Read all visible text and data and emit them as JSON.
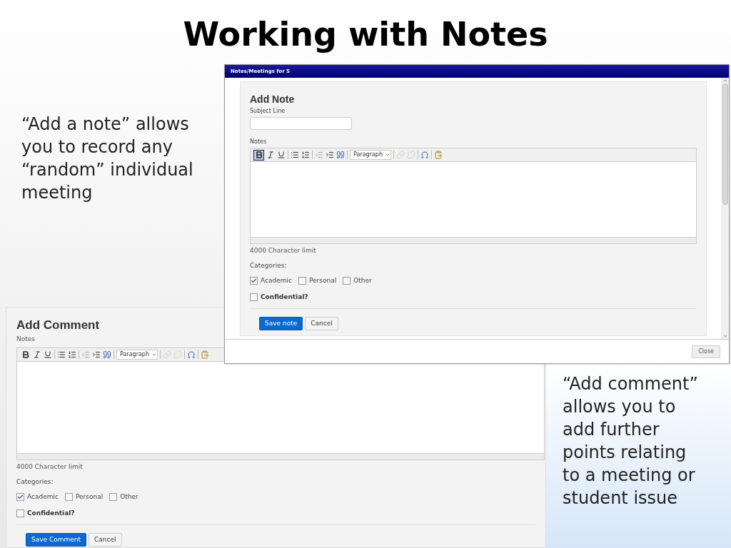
{
  "slide": {
    "title": "Working with Notes",
    "left_text": "“Add a note” allows you to record any “random” individual meeting",
    "right_text": "“Add comment” allows you to add further points relating to a meeting or student issue"
  },
  "note_dialog": {
    "title": "Notes/Meetings for S",
    "heading": "Add Note",
    "subject_label": "Subject Line",
    "notes_label": "Notes",
    "toolbar": {
      "bold_active": true,
      "format": "Paragraph"
    },
    "limit": "4000 Character limit",
    "categories_label": "Categories:",
    "categories": [
      {
        "label": "Academic",
        "checked": true
      },
      {
        "label": "Personal",
        "checked": false
      },
      {
        "label": "Other",
        "checked": false
      }
    ],
    "confidential": {
      "label": "Confidential?",
      "checked": false
    },
    "buttons": [
      {
        "label": "Save note",
        "kind": "primary"
      },
      {
        "label": "Cancel",
        "kind": "secondary"
      }
    ],
    "close": "Close"
  },
  "comment_panel": {
    "heading": "Add Comment",
    "notes_label": "Notes",
    "toolbar": {
      "bold_active": false,
      "format": "Paragraph"
    },
    "limit": "4000 Character limit",
    "categories_label": "Categories:",
    "categories": [
      {
        "label": "Academic",
        "checked": true
      },
      {
        "label": "Personal",
        "checked": false
      },
      {
        "label": "Other",
        "checked": false
      }
    ],
    "confidential": {
      "label": "Confidential?",
      "checked": false
    },
    "buttons": [
      {
        "label": "Save Comment",
        "kind": "primary"
      },
      {
        "label": "Cancel",
        "kind": "secondary"
      }
    ]
  }
}
